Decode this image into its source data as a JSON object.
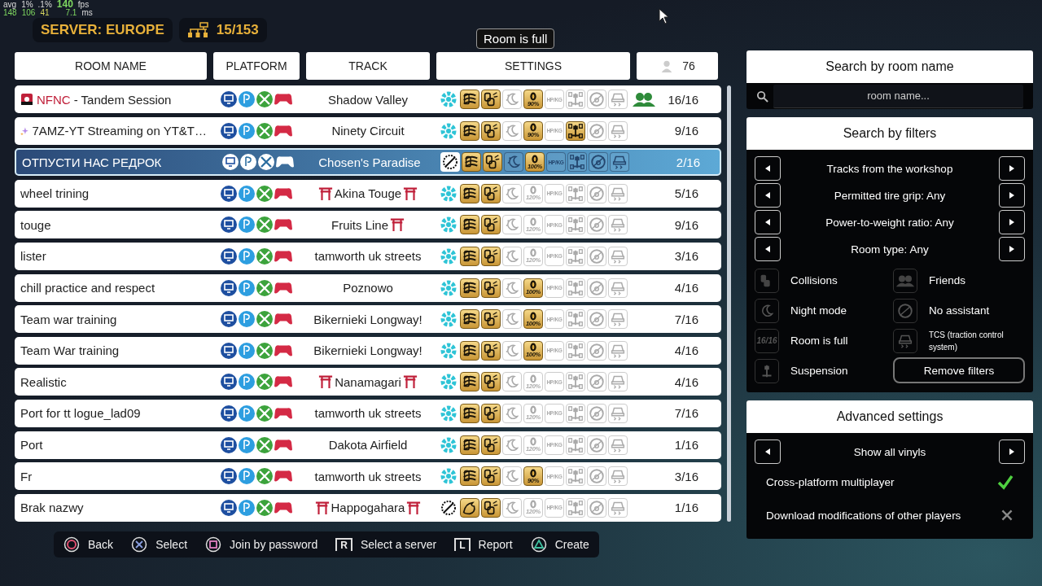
{
  "perf": {
    "labels": [
      "avg",
      "1%",
      ".1%"
    ],
    "fps": "140",
    "fps_unit": "fps",
    "values": [
      "148",
      "106",
      "41"
    ],
    "frame": "7.1",
    "frame_unit": "ms"
  },
  "server": {
    "label": "SERVER: EUROPE",
    "rooms": "15/153"
  },
  "tooltip": "Room is full",
  "columns": {
    "name": "ROOM NAME",
    "platform": "PLATFORM",
    "track": "TRACK",
    "settings": "SETTINGS",
    "players": "76"
  },
  "rooms": [
    {
      "tag": "NFNC",
      "name_icon": {
        "kind": "flag"
      },
      "name": "- Tandem Session",
      "track": "Shadow Valley",
      "torii_before": false,
      "torii_after": false,
      "selected": false,
      "room_type": {
        "kind": "workshop"
      },
      "mode": {
        "kind": "drift"
      },
      "grip": "90%",
      "grip_on": true,
      "power": "HP/KG",
      "suspension_on": false,
      "friends": true,
      "players": "16/16"
    },
    {
      "name_icon": {
        "kind": "sparkle"
      },
      "name": "7AMZ-YT Streaming on YT&T…",
      "track": "Ninety Circuit",
      "torii_before": false,
      "torii_after": false,
      "selected": false,
      "room_type": {
        "kind": "workshop"
      },
      "mode": {
        "kind": "drift"
      },
      "grip": "90%",
      "grip_on": true,
      "power": "HP/KG",
      "suspension_on": true,
      "friends": false,
      "players": "9/16"
    },
    {
      "name": "ОТПУСТИ НАС РЕДРОК",
      "track": "Chosen's Paradise",
      "torii_before": false,
      "torii_after": false,
      "selected": true,
      "room_type": {
        "kind": "custom"
      },
      "mode": {
        "kind": "drift"
      },
      "grip": "100%",
      "grip_on": true,
      "power": "HP/KG",
      "suspension_on": false,
      "friends": false,
      "players": "2/16"
    },
    {
      "name": "wheel trining",
      "track": "Akina Touge",
      "torii_before": true,
      "torii_after": true,
      "selected": false,
      "room_type": {
        "kind": "workshop"
      },
      "mode": {
        "kind": "drift"
      },
      "grip": "120%",
      "grip_on": false,
      "power": "HP/KG",
      "suspension_on": false,
      "friends": false,
      "players": "5/16"
    },
    {
      "name": "touge",
      "track": "Fruits Line",
      "torii_before": false,
      "torii_after": true,
      "selected": false,
      "room_type": {
        "kind": "workshop"
      },
      "mode": {
        "kind": "drift"
      },
      "grip": "120%",
      "grip_on": false,
      "power": "HP/KG",
      "suspension_on": false,
      "friends": false,
      "players": "9/16"
    },
    {
      "name": "lister",
      "track": "tamworth uk streets",
      "torii_before": false,
      "torii_after": false,
      "selected": false,
      "room_type": {
        "kind": "workshop"
      },
      "mode": {
        "kind": "drift"
      },
      "grip": "120%",
      "grip_on": false,
      "power": "HP/KG",
      "suspension_on": false,
      "friends": false,
      "players": "3/16"
    },
    {
      "name": "chill practice and respect",
      "track": "Poznowo",
      "torii_before": false,
      "torii_after": false,
      "selected": false,
      "room_type": {
        "kind": "workshop"
      },
      "mode": {
        "kind": "drift"
      },
      "grip": "100%",
      "grip_on": true,
      "power": "HP/KG",
      "suspension_on": false,
      "friends": false,
      "players": "4/16"
    },
    {
      "name": "Team war training",
      "track": "Bikernieki Longway!",
      "torii_before": false,
      "torii_after": false,
      "selected": false,
      "room_type": {
        "kind": "workshop"
      },
      "mode": {
        "kind": "drift"
      },
      "grip": "100%",
      "grip_on": true,
      "power": "HP/KG",
      "suspension_on": false,
      "friends": false,
      "players": "7/16"
    },
    {
      "name": "Team War training",
      "track": "Bikernieki Longway!",
      "torii_before": false,
      "torii_after": false,
      "selected": false,
      "room_type": {
        "kind": "workshop"
      },
      "mode": {
        "kind": "drift"
      },
      "grip": "100%",
      "grip_on": true,
      "power": "HP/KG",
      "suspension_on": false,
      "friends": false,
      "players": "4/16"
    },
    {
      "name": "Realistic",
      "track": "Nanamagari",
      "torii_before": true,
      "torii_after": true,
      "selected": false,
      "room_type": {
        "kind": "workshop"
      },
      "mode": {
        "kind": "drift"
      },
      "grip": "120%",
      "grip_on": false,
      "power": "HP/KG",
      "suspension_on": false,
      "friends": false,
      "players": "4/16"
    },
    {
      "name": "Port for tt logue_lad09",
      "track": "tamworth uk streets",
      "torii_before": false,
      "torii_after": false,
      "selected": false,
      "room_type": {
        "kind": "workshop"
      },
      "mode": {
        "kind": "drift"
      },
      "grip": "120%",
      "grip_on": false,
      "power": "HP/KG",
      "suspension_on": false,
      "friends": false,
      "players": "7/16"
    },
    {
      "name": "Port",
      "track": "Dakota Airfield",
      "torii_before": false,
      "torii_after": false,
      "selected": false,
      "room_type": {
        "kind": "workshop"
      },
      "mode": {
        "kind": "drift"
      },
      "grip": "120%",
      "grip_on": false,
      "power": "HP/KG",
      "suspension_on": false,
      "friends": false,
      "players": "1/16"
    },
    {
      "name": "Fr",
      "track": "tamworth uk streets",
      "torii_before": false,
      "torii_after": false,
      "selected": false,
      "room_type": {
        "kind": "workshop"
      },
      "mode": {
        "kind": "drift"
      },
      "grip": "90%",
      "grip_on": true,
      "power": "HP/KG",
      "suspension_on": false,
      "friends": false,
      "players": "3/16"
    },
    {
      "name": "Brak nazwy",
      "track": "Happogahara",
      "torii_before": true,
      "torii_after": true,
      "selected": false,
      "room_type": {
        "kind": "custom"
      },
      "mode": {
        "kind": "speed"
      },
      "grip": "120%",
      "grip_on": false,
      "power": "HP/KG",
      "suspension_on": false,
      "friends": false,
      "players": "1/16"
    }
  ],
  "search": {
    "title": "Search by room name",
    "placeholder": "room name..."
  },
  "filters": {
    "title": "Search by filters",
    "selectors": [
      {
        "label": "Tracks from the workshop"
      },
      {
        "label": "Permitted tire grip: Any"
      },
      {
        "label": "Power-to-weight ratio: Any"
      },
      {
        "label": "Room type: Any"
      }
    ],
    "toggles": [
      {
        "kind": "collisions",
        "label": "Collisions"
      },
      {
        "kind": "friends",
        "label": "Friends"
      },
      {
        "kind": "night",
        "label": "Night mode"
      },
      {
        "kind": "assistant",
        "label": "No assistant"
      },
      {
        "kind": "full",
        "label": "Room is full",
        "icon_text": "16/16"
      },
      {
        "kind": "tcs",
        "label": "TCS (traction control system)"
      },
      {
        "kind": "suspension",
        "label": "Suspension"
      }
    ],
    "remove": "Remove filters"
  },
  "advanced": {
    "title": "Advanced settings",
    "selector": "Show all vinyls",
    "options": [
      {
        "label": "Cross-platform multiplayer",
        "on": true
      },
      {
        "label": "Download modifications of other players",
        "on": false
      }
    ]
  },
  "hints": [
    {
      "kind": "circle",
      "label": "Back"
    },
    {
      "kind": "cross",
      "label": "Select"
    },
    {
      "kind": "square",
      "label": "Join by password"
    },
    {
      "kind": "trigger",
      "glyph": "R",
      "label": "Select a server"
    },
    {
      "kind": "trigger",
      "glyph": "L",
      "label": "Report"
    },
    {
      "kind": "triangle",
      "label": "Create"
    }
  ]
}
